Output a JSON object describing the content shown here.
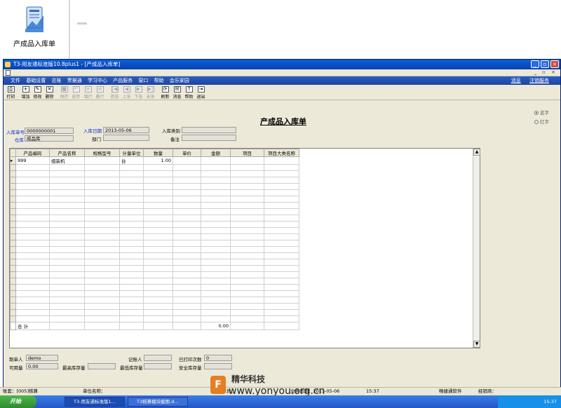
{
  "desktop": {
    "icon_label": "产成品入库单"
  },
  "window": {
    "title": "T3-用友通标准版10.8plus1 - [产成品入库单]",
    "menu": [
      "文件",
      "基础设置",
      "总账",
      "票据通",
      "学习中心",
      "产品服务",
      "窗口",
      "帮助",
      "会乐家园"
    ],
    "menu_right": [
      "消息",
      "注销服务"
    ]
  },
  "toolbar": [
    {
      "label": "打印",
      "glyph": "⎙",
      "enabled": true
    },
    {
      "label": "增加",
      "glyph": "+",
      "enabled": true
    },
    {
      "label": "修改",
      "glyph": "✎",
      "enabled": true
    },
    {
      "label": "删除",
      "glyph": "✕",
      "enabled": true
    },
    {
      "label": "保存",
      "glyph": "■",
      "enabled": false
    },
    {
      "label": "放弃",
      "glyph": "↶",
      "enabled": false
    },
    {
      "label": "增行",
      "glyph": "≡",
      "enabled": false
    },
    {
      "label": "删行",
      "glyph": "≡",
      "enabled": false
    },
    {
      "label": "首张",
      "glyph": "|◀",
      "enabled": false
    },
    {
      "label": "上张",
      "glyph": "◀",
      "enabled": false
    },
    {
      "label": "下张",
      "glyph": "▶",
      "enabled": false
    },
    {
      "label": "末张",
      "glyph": "▶|",
      "enabled": false
    },
    {
      "label": "刷新",
      "glyph": "⟳",
      "enabled": true
    },
    {
      "label": "消息",
      "glyph": "✉",
      "enabled": true
    },
    {
      "label": "帮助",
      "glyph": "?",
      "enabled": true
    },
    {
      "label": "退出",
      "glyph": "⇥",
      "enabled": true
    }
  ],
  "form": {
    "title": "产成品入库单",
    "radio_blue": "蓝字",
    "radio_red": "红字",
    "doc_no_label": "入库单号",
    "doc_no": "0000000001",
    "date_label": "入库日期",
    "date": "2013-05-06",
    "type_label": "入库类别",
    "type": "",
    "warehouse_label": "仓库",
    "warehouse": "成品库",
    "dept_label": "部门",
    "dept": "",
    "remark_label": "备注",
    "remark": ""
  },
  "grid": {
    "columns": [
      "产品编码",
      "产品名称",
      "规格型号",
      "计量单位",
      "数量",
      "单价",
      "金额",
      "项目",
      "项目大类名称"
    ],
    "rows": [
      [
        "999",
        "组装机",
        "",
        "台",
        "1.00",
        "",
        "",
        "",
        ""
      ]
    ],
    "total_label": "合  计",
    "total_amount": "0.00"
  },
  "footer": {
    "maker_label": "制单人",
    "maker": "demo",
    "checker_label": "记账人",
    "checker": "",
    "print_count_label": "已打印次数",
    "print_count": "0",
    "available_label": "可用量",
    "available": "0.00",
    "max_stock_label": "最高库存量",
    "max_stock": "",
    "min_stock_label": "最低库存量",
    "min_stock": "",
    "safe_stock_label": "安全库存量",
    "safe_stock": ""
  },
  "status": {
    "account": "账套：[005]核算",
    "company": "单位名称：",
    "operator": "操作员：",
    "date": "业务日期：2013-05-06",
    "time": "15:37",
    "vendor": "畅捷通软件",
    "dealer": "经销商："
  },
  "taskbar": {
    "start": "开始",
    "items": [
      "T3-用友通标准版1...",
      "T3核算模块截图.d..."
    ],
    "clock": "15:37"
  },
  "watermark": {
    "brand": "精华科技",
    "url": "www.yonyou.org.cn"
  }
}
